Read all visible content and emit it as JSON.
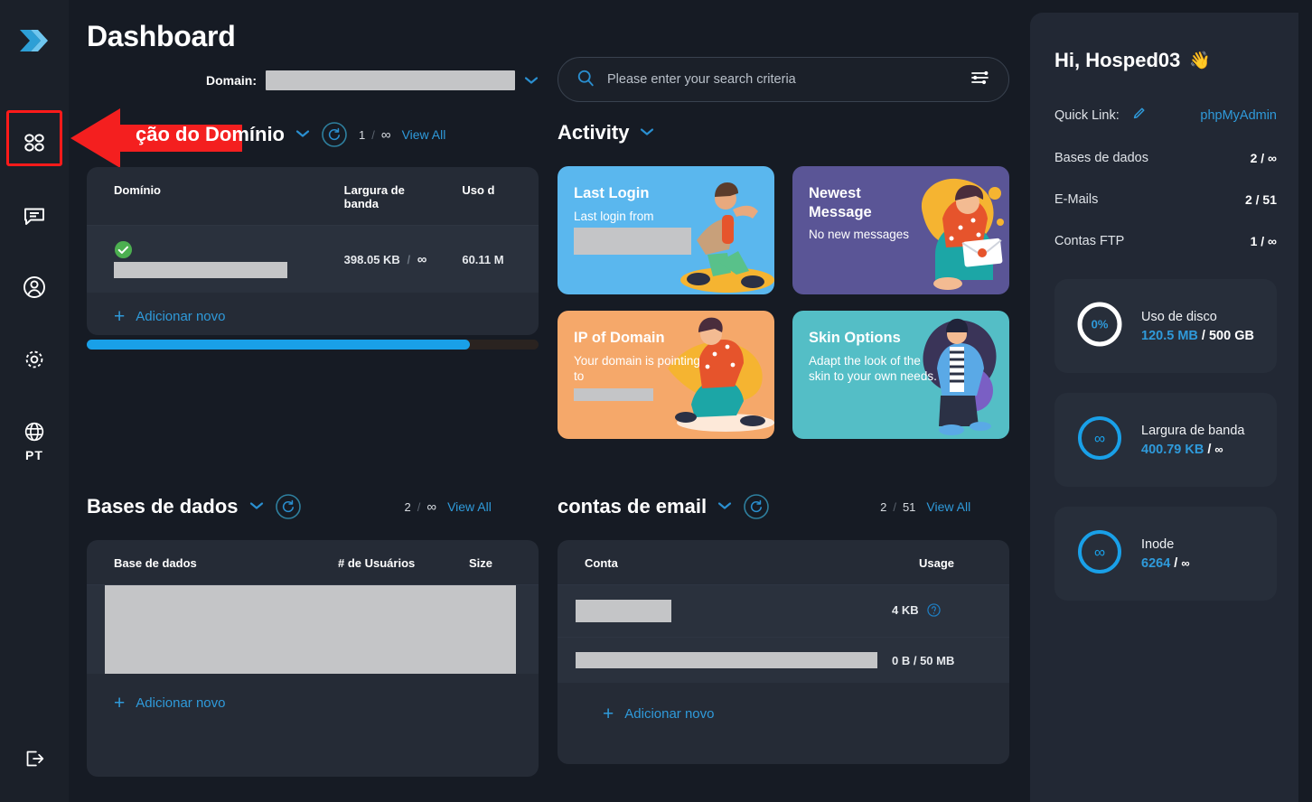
{
  "app": {
    "logo_icon": "double-chevron-logo",
    "page_title": "Dashboard"
  },
  "left_rail": {
    "items": [
      {
        "icon": "apps-grid-icon",
        "name": "apps",
        "selected": true
      },
      {
        "icon": "chat-message-icon",
        "name": "messages",
        "selected": false
      },
      {
        "icon": "user-circle-icon",
        "name": "account",
        "selected": false
      },
      {
        "icon": "gear-settings-icon",
        "name": "settings",
        "selected": false
      },
      {
        "icon": "globe-language-icon",
        "name": "language",
        "selected": false
      }
    ],
    "language_code": "PT",
    "logout_icon": "logout-icon"
  },
  "header": {
    "domain_label": "Domain:",
    "domain_value": "",
    "domain_dropdown_icon": "chevron-down-icon"
  },
  "search": {
    "placeholder": "Please enter your search criteria",
    "value": "",
    "search_icon": "search-icon",
    "filter_icon": "sliders-filter-icon"
  },
  "sections": {
    "domain_admin": {
      "title": "ção do Domínio",
      "dropdown_icon": "chevron-down-icon",
      "refresh_icon": "refresh-icon",
      "count_current": "1",
      "count_separator": "/",
      "count_total": "∞",
      "view_all": "View All",
      "columns": [
        "Domínio",
        "Largura de banda",
        "Uso d"
      ],
      "rows": [
        {
          "status_icon": "check-circle-icon",
          "domain": "",
          "bandwidth_used": "398.05 KB",
          "bandwidth_sep": "/",
          "bandwidth_limit": "∞",
          "disk": "60.11 M"
        }
      ],
      "add_new": "Adicionar novo",
      "add_icon": "plus-icon"
    },
    "activity": {
      "title": "Activity",
      "dropdown_icon": "chevron-down-icon",
      "tiles": [
        {
          "title": "Last Login",
          "subtitle": "Last login from",
          "redacted": true,
          "color": "#5ab7ee",
          "art": "running-man"
        },
        {
          "title": "Newest Message",
          "subtitle": "No new messages",
          "redacted": false,
          "color": "#5a5596",
          "art": "woman-letter"
        },
        {
          "title": "IP of Domain",
          "subtitle": "Your domain is pointing to",
          "redacted": true,
          "color": "#f5a86a",
          "art": "woman-kneeling"
        },
        {
          "title": "Skin Options",
          "subtitle": "Adapt the look of the skin to your own needs.",
          "redacted": false,
          "color": "#54bec6",
          "art": "man-standing"
        }
      ]
    },
    "databases": {
      "title": "Bases de dados",
      "dropdown_icon": "chevron-down-icon",
      "refresh_icon": "refresh-icon",
      "count_current": "2",
      "count_separator": "/",
      "count_total": "∞",
      "view_all": "View All",
      "columns": [
        "Base de dados",
        "# de Usuários",
        "Size"
      ],
      "rows": [
        {
          "name": "",
          "users": "",
          "size": ""
        }
      ],
      "add_new": "Adicionar novo",
      "add_icon": "plus-icon"
    },
    "email_accounts": {
      "title": "contas de email",
      "dropdown_icon": "chevron-down-icon",
      "refresh_icon": "refresh-icon",
      "count_current": "2",
      "count_separator": "/",
      "count_total": "51",
      "view_all": "View All",
      "columns": [
        "Conta",
        "Usage"
      ],
      "rows": [
        {
          "account": "",
          "usage": "4 KB",
          "help_icon": "question-circle-icon"
        },
        {
          "account": "",
          "usage": "0 B / 50 MB",
          "help_icon": ""
        }
      ],
      "add_new": "Adicionar novo",
      "add_icon": "plus-icon"
    }
  },
  "right_panel": {
    "greeting": "Hi, Hosped03",
    "greeting_emoji": "👋",
    "quick_link_label": "Quick Link:",
    "quick_link_edit_icon": "pencil-edit-icon",
    "quick_link_value": "phpMyAdmin",
    "rows": [
      {
        "label": "Bases de dados",
        "value": "2 / ∞"
      },
      {
        "label": "E-Mails",
        "value": "2 / 51"
      },
      {
        "label": "Contas FTP",
        "value": "1 / ∞"
      }
    ],
    "stats": [
      {
        "gauge_label": "0%",
        "gauge_type": "percent",
        "gauge_color": "#ffffff",
        "title": "Uso de disco",
        "used": "120.5 MB",
        "separator": "/",
        "limit": "500 GB"
      },
      {
        "gauge_label": "∞",
        "gauge_type": "infinity",
        "gauge_color": "#19a0e8",
        "title": "Largura de banda",
        "used": "400.79 KB",
        "separator": "/",
        "limit": "∞"
      },
      {
        "gauge_label": "∞",
        "gauge_type": "infinity",
        "gauge_color": "#19a0e8",
        "title": "Inode",
        "used": "6264",
        "separator": "/",
        "limit": "∞"
      }
    ]
  },
  "annotation": {
    "arrow_color": "#ff1a1a",
    "highlight_target": "apps-grid-icon"
  },
  "colors": {
    "background": "#161b24",
    "panel": "#252b36",
    "accent": "#2f9ada",
    "rail": "#1b2029"
  }
}
